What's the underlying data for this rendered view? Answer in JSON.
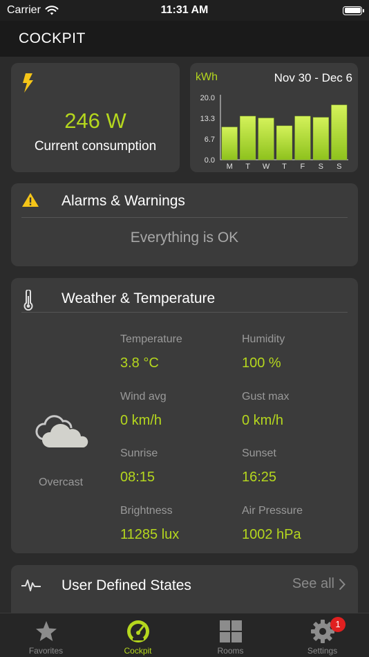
{
  "status_bar": {
    "carrier": "Carrier",
    "time": "11:31 AM"
  },
  "header": {
    "title": "COCKPIT"
  },
  "power": {
    "value": "246 W",
    "label": "Current consumption",
    "icon": "bolt-icon"
  },
  "energy_chart": {
    "unit": "kWh",
    "range": "Nov 30 - Dec 6",
    "colors": {
      "bar_top": "#d4f25a",
      "bar_bottom": "#8ec21d"
    }
  },
  "chart_data": {
    "type": "bar",
    "categories": [
      "M",
      "T",
      "W",
      "T",
      "F",
      "S",
      "S"
    ],
    "values": [
      10.5,
      14,
      13.4,
      10.9,
      14,
      13.6,
      17.6
    ],
    "ylabel": "kWh",
    "ylim": [
      0,
      20
    ],
    "yticks": [
      "20.0",
      "13.3",
      "6.7",
      "0.0"
    ],
    "ytick_values": [
      20,
      13.3,
      6.7,
      0
    ],
    "grid": false
  },
  "alarms": {
    "title": "Alarms & Warnings",
    "status": "Everything is OK",
    "icon": "warning-icon",
    "icon_color": "#f5c518"
  },
  "weather": {
    "title": "Weather & Temperature",
    "condition": "Overcast",
    "items": [
      {
        "label": "Temperature",
        "value": "3.8 °C"
      },
      {
        "label": "Humidity",
        "value": "100 %"
      },
      {
        "label": "Wind avg",
        "value": "0 km/h"
      },
      {
        "label": "Gust max",
        "value": "0 km/h"
      },
      {
        "label": "Sunrise",
        "value": "08:15"
      },
      {
        "label": "Sunset",
        "value": "16:25"
      },
      {
        "label": "Brightness",
        "value": "11285 lux"
      },
      {
        "label": "Air Pressure",
        "value": "1002 hPa"
      }
    ]
  },
  "user_states": {
    "title": "User Defined States",
    "see_all": "See all"
  },
  "tabs": [
    {
      "label": "Favorites",
      "icon": "star-icon"
    },
    {
      "label": "Cockpit",
      "icon": "gauge-icon",
      "active": true
    },
    {
      "label": "Rooms",
      "icon": "grid-icon"
    },
    {
      "label": "Settings",
      "icon": "gear-icon",
      "badge": "1"
    }
  ],
  "accent_color": "#b5d71e"
}
